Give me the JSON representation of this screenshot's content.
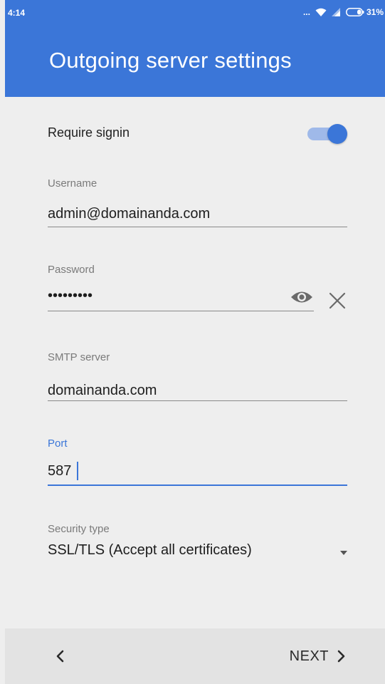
{
  "status_bar": {
    "time": "4:14",
    "more": "...",
    "battery": "31%"
  },
  "header": {
    "title": "Outgoing server settings"
  },
  "require_signin": {
    "label": "Require signin",
    "enabled": true
  },
  "username": {
    "label": "Username",
    "value": "admin@domainanda.com"
  },
  "password": {
    "label": "Password",
    "masked_value": "•••••••••"
  },
  "smtp_server": {
    "label": "SMTP server",
    "value": "domainanda.com"
  },
  "port": {
    "label": "Port",
    "value": "587"
  },
  "security_type": {
    "label": "Security type",
    "selected": "SSL/TLS (Accept all certificates)"
  },
  "footer": {
    "next_label": "NEXT"
  },
  "icons": {
    "wifi": "wifi-icon",
    "signal": "signal-icon",
    "battery": "battery-icon",
    "visibility": "eye-icon",
    "clear": "close-icon",
    "dropdown": "dropdown-arrow-icon",
    "back": "chevron-left-icon",
    "next": "chevron-right-icon"
  },
  "colors": {
    "primary": "#3b76d8",
    "toggle_track": "#9fb9e9",
    "background": "#eeeeee",
    "bottom_bar": "#e3e3e3"
  }
}
